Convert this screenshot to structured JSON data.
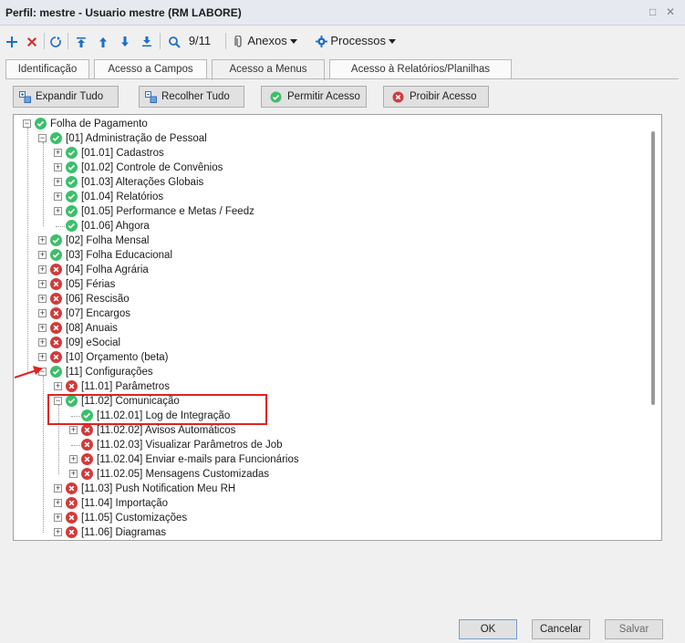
{
  "window": {
    "title": "Perfil: mestre - Usuario mestre (RM LABORE)",
    "controls": [
      "□",
      "✕"
    ]
  },
  "toolbar": {
    "record_counter": "9/11",
    "anexos_label": "Anexos",
    "processos_label": "Processos"
  },
  "tabs": [
    {
      "label": "Identificação"
    },
    {
      "label": "Acesso a Campos"
    },
    {
      "label": "Acesso a Menus"
    },
    {
      "label": "Acesso à Relatórios/Planilhas"
    }
  ],
  "active_tab": "Acesso a Menus",
  "actions": {
    "expand_all": "Expandir Tudo",
    "collapse_all": "Recolher Tudo",
    "allow": "Permitir Acesso",
    "deny": "Proibir Acesso"
  },
  "tree": [
    {
      "label": "Folha de Pagamento",
      "level": 0,
      "status": "allowed",
      "expander": "−"
    },
    {
      "label": "[01] Administração de Pessoal",
      "level": 1,
      "status": "allowed",
      "expander": "−"
    },
    {
      "label": "[01.01] Cadastros",
      "level": 2,
      "status": "allowed",
      "expander": "+"
    },
    {
      "label": "[01.02] Controle de Convênios",
      "level": 2,
      "status": "allowed",
      "expander": "+"
    },
    {
      "label": "[01.03] Alterações Globais",
      "level": 2,
      "status": "allowed",
      "expander": "+"
    },
    {
      "label": "[01.04] Relatórios",
      "level": 2,
      "status": "allowed",
      "expander": "+"
    },
    {
      "label": "[01.05] Performance e Metas / Feedz",
      "level": 2,
      "status": "allowed",
      "expander": "+"
    },
    {
      "label": "[01.06] Ahgora",
      "level": 2,
      "status": "allowed",
      "expander": ""
    },
    {
      "label": "[02] Folha Mensal",
      "level": 1,
      "status": "allowed",
      "expander": "+"
    },
    {
      "label": "[03] Folha Educacional",
      "level": 1,
      "status": "allowed",
      "expander": "+"
    },
    {
      "label": "[04] Folha Agrária",
      "level": 1,
      "status": "denied",
      "expander": "+"
    },
    {
      "label": "[05] Férias",
      "level": 1,
      "status": "denied",
      "expander": "+"
    },
    {
      "label": "[06] Rescisão",
      "level": 1,
      "status": "denied",
      "expander": "+"
    },
    {
      "label": "[07] Encargos",
      "level": 1,
      "status": "denied",
      "expander": "+"
    },
    {
      "label": "[08] Anuais",
      "level": 1,
      "status": "denied",
      "expander": "+"
    },
    {
      "label": "[09] eSocial",
      "level": 1,
      "status": "denied",
      "expander": "+"
    },
    {
      "label": "[10] Orçamento (beta)",
      "level": 1,
      "status": "denied",
      "expander": "+"
    },
    {
      "label": "[11] Configurações",
      "level": 1,
      "status": "allowed",
      "expander": "−"
    },
    {
      "label": "[11.01] Parâmetros",
      "level": 2,
      "status": "denied",
      "expander": "+"
    },
    {
      "label": "[11.02] Comunicação",
      "level": 2,
      "status": "allowed",
      "expander": "−"
    },
    {
      "label": "[11.02.01] Log de Integração",
      "level": 3,
      "status": "allowed",
      "expander": ""
    },
    {
      "label": "[11.02.02] Avisos Automáticos",
      "level": 3,
      "status": "denied",
      "expander": "+"
    },
    {
      "label": "[11.02.03] Visualizar Parâmetros de Job",
      "level": 3,
      "status": "denied",
      "expander": ""
    },
    {
      "label": "[11.02.04] Enviar e-mails para Funcionários",
      "level": 3,
      "status": "denied",
      "expander": "+"
    },
    {
      "label": "[11.02.05] Mensagens Customizadas",
      "level": 3,
      "status": "denied",
      "expander": "+"
    },
    {
      "label": "[11.03] Push Notification Meu RH",
      "level": 2,
      "status": "denied",
      "expander": "+"
    },
    {
      "label": "[11.04] Importação",
      "level": 2,
      "status": "denied",
      "expander": "+"
    },
    {
      "label": "[11.05] Customizações",
      "level": 2,
      "status": "denied",
      "expander": "+"
    },
    {
      "label": "[11.06] Diagramas",
      "level": 2,
      "status": "denied",
      "expander": "+"
    }
  ],
  "footer": {
    "ok": "OK",
    "cancel": "Cancelar",
    "save": "Salvar"
  },
  "colors": {
    "allowed": "#3bbf6a",
    "denied": "#d23a3a",
    "highlight": "#e02222"
  }
}
